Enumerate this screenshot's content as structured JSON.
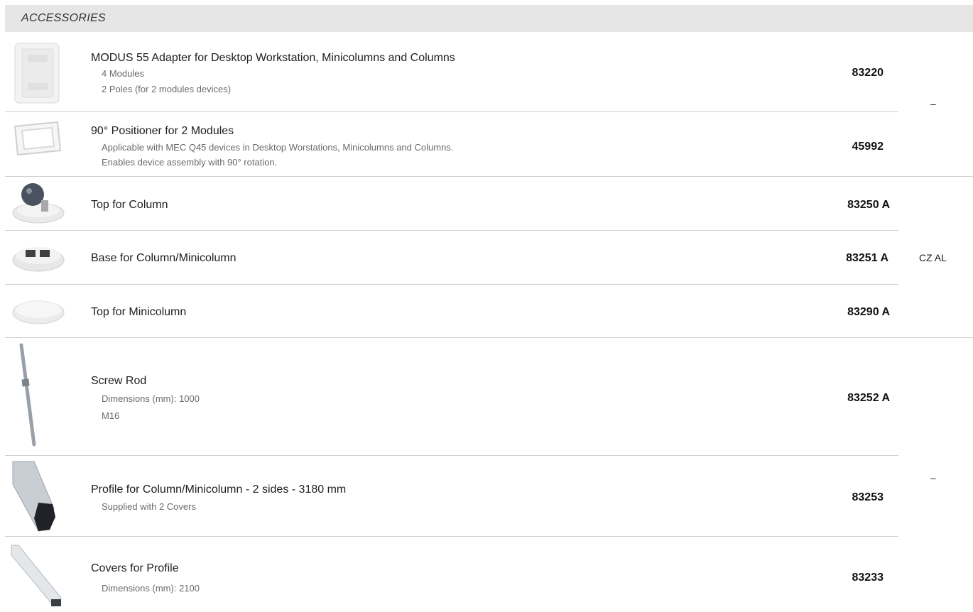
{
  "section": {
    "title": "ACCESSORIES"
  },
  "rows": [
    {
      "title": "MODUS 55 Adapter for Desktop Workstation, Minicolumns and Columns",
      "details": [
        "4 Modules",
        "2 Poles (for 2 modules devices)"
      ],
      "code": "83220",
      "image": "adapter-icon"
    },
    {
      "title": "90° Positioner for 2 Modules",
      "details": [
        "Applicable with MEC Q45 devices in Desktop Worstations, Minicolumns and Columns.",
        "Enables device assembly with 90° rotation."
      ],
      "code": "45992",
      "image": "positioner-icon"
    },
    {
      "title": "Top for Column",
      "details": [],
      "code": "83250 A",
      "image": "column-top-icon"
    },
    {
      "title": "Base for Column/Minicolumn",
      "details": [],
      "code": "83251 A",
      "image": "column-base-icon"
    },
    {
      "title": "Top for Minicolumn",
      "details": [],
      "code": "83290 A",
      "image": "minicolumn-top-icon"
    },
    {
      "title": "Screw Rod",
      "details": [
        "Dimensions (mm): 1000",
        "M16"
      ],
      "code": "83252 A",
      "image": "screw-rod-icon"
    },
    {
      "title": "Profile for Column/Minicolumn - 2 sides - 3180 mm",
      "details": [
        "Supplied with 2 Covers"
      ],
      "code": "83253",
      "image": "profile-icon"
    },
    {
      "title": "Covers for Profile",
      "details": [
        "Dimensions (mm): 2100"
      ],
      "code": "83233",
      "image": "cover-icon"
    }
  ],
  "finish_groups": [
    {
      "label": "–"
    },
    {
      "label": "CZ AL"
    },
    {
      "label": "–"
    }
  ]
}
